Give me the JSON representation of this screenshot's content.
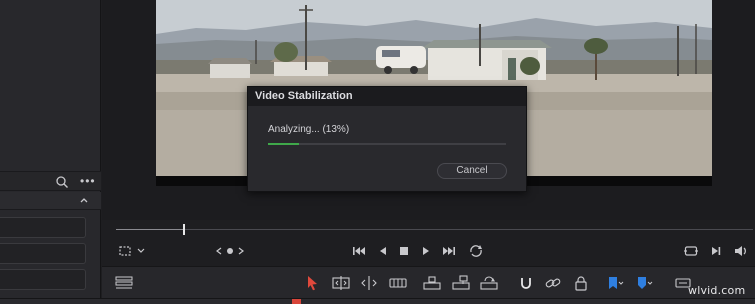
{
  "dialog": {
    "title": "Video Stabilization",
    "status": "Analyzing... (13%)",
    "progress": 0.13,
    "cancel_label": "Cancel"
  },
  "viewer": {
    "scrubber_position": 0.11
  },
  "colors": {
    "progress": "#3fa84a",
    "selection_tool": "#e0493c",
    "flag": "#2f7fe0",
    "marker": "#2f7fe0",
    "ruler_marker": "#d8453a"
  },
  "left_panel": {
    "toolbar_icons": [
      "search-icon",
      "more-options-icon"
    ],
    "section_icon": "chevron-up-icon"
  },
  "transport": {
    "icons": [
      "crop-icon",
      "chevron-down-icon",
      "prev-clip-icon",
      "clip-dot-icon",
      "next-clip-icon",
      "go-to-first-frame-icon",
      "play-reverse-icon",
      "stop-icon",
      "play-icon",
      "go-to-last-frame-icon",
      "loop-icon",
      "fullscreen-icon",
      "next-frame-icon",
      "volume-icon"
    ]
  },
  "edit_toolbar": {
    "icons": [
      "timeline-view-icon",
      "selection-tool-icon",
      "trim-tool-icon",
      "dynamic-trim-icon",
      "blade-tool-icon",
      "insert-clip-icon",
      "overwrite-clip-icon",
      "replace-clip-icon",
      "snapping-icon",
      "linked-selection-icon",
      "position-lock-icon",
      "flag-icon",
      "marker-icon",
      "zoom-icon"
    ]
  },
  "watermark": "wlvid.com"
}
